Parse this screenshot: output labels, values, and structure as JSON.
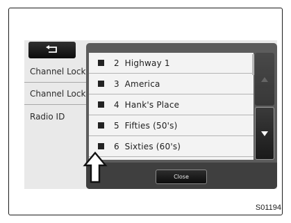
{
  "background_screen": {
    "rows": [
      {
        "label": "Channel Lock"
      },
      {
        "label": "Channel Lock"
      },
      {
        "label": "Radio ID"
      }
    ]
  },
  "popup": {
    "items": [
      {
        "number": "2",
        "name": "Highway 1"
      },
      {
        "number": "3",
        "name": "America"
      },
      {
        "number": "4",
        "name": "Hank's Place"
      },
      {
        "number": "5",
        "name": "Fifties (50's)"
      },
      {
        "number": "6",
        "name": "Sixties (60's)"
      }
    ],
    "close_label": "Close"
  },
  "icons": {
    "back": "return-arrow-icon",
    "scroll_up": "triangle-up-icon",
    "scroll_down": "triangle-down-icon",
    "pointer": "callout-up-arrow-icon"
  },
  "figure_code": "S01194"
}
